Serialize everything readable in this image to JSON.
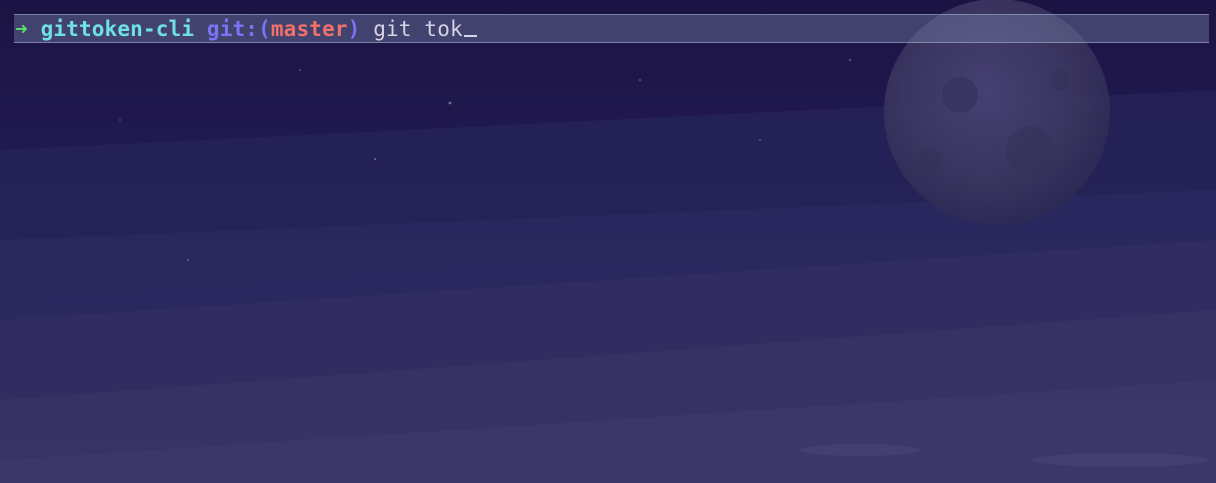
{
  "terminal": {
    "prompt_arrow": "➜",
    "directory": "gittoken-cli",
    "git_prefix": "git:(",
    "branch": "master",
    "git_suffix": ")",
    "command": "git tok"
  },
  "colors": {
    "arrow": "#58e06a",
    "directory": "#6fe0e6",
    "git_label": "#7a74f2",
    "branch": "#f0716a",
    "command_text": "#d6d3e3",
    "background": "#1e1546"
  },
  "icons": {
    "background": "moon-night-sky-wallpaper"
  }
}
